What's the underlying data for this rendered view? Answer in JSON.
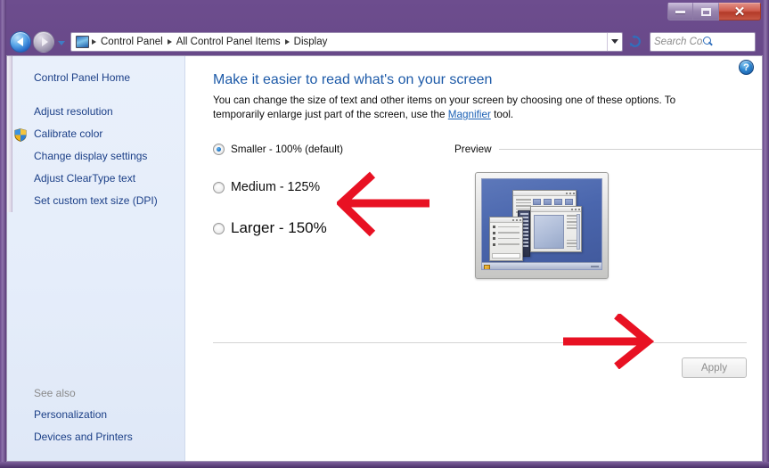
{
  "window": {
    "title": "Display",
    "buttons": {
      "minimize": "minimize-button",
      "maximize": "maximize-button",
      "close": "✕"
    }
  },
  "navbar": {
    "back_tooltip": "Back",
    "forward_tooltip": "Forward",
    "breadcrumbs": [
      "Control Panel",
      "All Control Panel Items",
      "Display"
    ],
    "refresh_glyph": "↻",
    "search": {
      "placeholder": "Search Con...",
      "value": ""
    }
  },
  "sidebar": {
    "home_label": "Control Panel Home",
    "items": [
      {
        "label": "Adjust resolution",
        "icon": null
      },
      {
        "label": "Calibrate color",
        "icon": "uac-shield-icon"
      },
      {
        "label": "Change display settings",
        "icon": null
      },
      {
        "label": "Adjust ClearType text",
        "icon": null
      },
      {
        "label": "Set custom text size (DPI)",
        "icon": null
      }
    ],
    "see_also_label": "See also",
    "see_also_items": [
      {
        "label": "Personalization"
      },
      {
        "label": "Devices and Printers"
      }
    ]
  },
  "content": {
    "help_glyph": "?",
    "title": "Make it easier to read what's on your screen",
    "description_part1": "You can change the size of text and other items on your screen by choosing one of these options. To temporarily enlarge just part of the screen, use the ",
    "description_link": "Magnifier",
    "description_part2": " tool.",
    "options": [
      {
        "label": "Smaller - 100% (default)",
        "selected": true,
        "scale": "100%"
      },
      {
        "label": "Medium - 125%",
        "selected": false,
        "scale": "125%"
      },
      {
        "label": "Larger - 150%",
        "selected": false,
        "scale": "150%"
      }
    ],
    "preview_label": "Preview",
    "apply_label": "Apply",
    "apply_enabled": false
  },
  "annotations": [
    {
      "name": "arrow-pointing-to-medium-option",
      "direction": "left",
      "color": "#e81123"
    },
    {
      "name": "arrow-pointing-to-apply-button",
      "direction": "right",
      "color": "#e81123"
    }
  ],
  "colors": {
    "frame": "#5d3f7d",
    "accent_link": "#1b3f87",
    "title_blue": "#1d5aa8",
    "sidebar_bg": "#e7eefa",
    "annotation_red": "#e81123",
    "close_red": "#c75744"
  }
}
